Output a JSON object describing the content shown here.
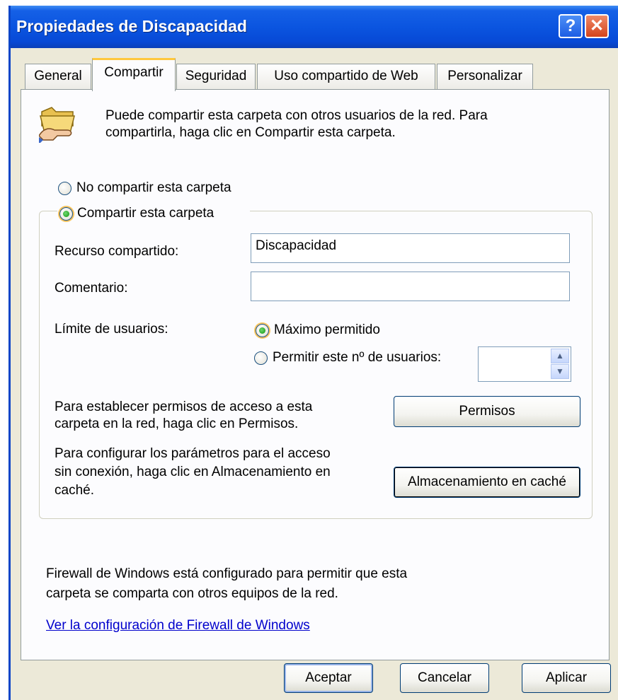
{
  "window": {
    "title": "Propiedades de Discapacidad",
    "help_label": "?",
    "close_label": "✕"
  },
  "tabs": [
    {
      "label": "General"
    },
    {
      "label": "Compartir"
    },
    {
      "label": "Seguridad"
    },
    {
      "label": "Uso compartido de Web"
    },
    {
      "label": "Personalizar"
    }
  ],
  "intro": {
    "line1": "Puede compartir esta carpeta con otros usuarios de la red. Para",
    "line2": "compartirla, haga clic en Compartir esta carpeta."
  },
  "sharing": {
    "no_share_label": "No compartir esta carpeta",
    "share_label": "Compartir esta carpeta",
    "selected": "share"
  },
  "fields": {
    "share_name_label": "Recurso compartido:",
    "share_name_value": "Discapacidad",
    "comment_label": "Comentario:",
    "comment_value": ""
  },
  "user_limit": {
    "label": "Límite de usuarios:",
    "max_label": "Máximo permitido",
    "allow_label": "Permitir este nº de usuarios:",
    "selected": "max",
    "count_value": ""
  },
  "permissions": {
    "line1": "Para establecer permisos de acceso a esta",
    "line2": "carpeta en la red, haga clic en Permisos.",
    "button": "Permisos"
  },
  "caching": {
    "line1": "Para configurar los parámetros para el acceso",
    "line2": "sin conexión, haga clic en Almacenamiento en",
    "line3": "caché.",
    "button": "Almacenamiento en caché"
  },
  "firewall": {
    "line1": "Firewall de Windows está configurado para permitir que esta",
    "line2": "carpeta se comparta con otros equipos de la red.",
    "link": "Ver la configuración de Firewall de Windows"
  },
  "buttons": {
    "ok": "Aceptar",
    "cancel": "Cancelar",
    "apply": "Aplicar"
  },
  "colors": {
    "titlebar": "#0b55e0",
    "dialog_bg": "#ece9d8",
    "panel_bg": "#fcfcfe",
    "link": "#0000cc",
    "tab_highlight": "#ffc83c"
  }
}
